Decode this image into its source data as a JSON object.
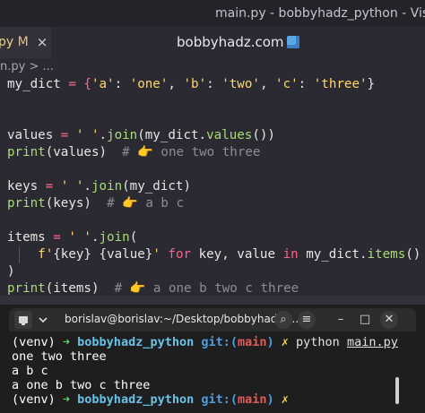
{
  "window": {
    "title": "main.py - bobbyhadz_python - Visual Studio"
  },
  "tab": {
    "label": "py",
    "modified": "M",
    "close": "×"
  },
  "header": {
    "center_title": "bobbyhadz.com"
  },
  "breadcrumb": {
    "text": "n.py > ..."
  },
  "code": {
    "l1": {
      "a": "my_dict",
      "b": " = {",
      "c": "'a'",
      "d": ": ",
      "e": "'one'",
      "f": ", ",
      "g": "'b'",
      "h": ": ",
      "i": "'two'",
      "j": ", ",
      "k": "'c'",
      "l": ": ",
      "m": "'three'",
      "n": "}"
    },
    "l4": {
      "a": "values",
      "b": " = ",
      "c": "' '",
      "d": ".",
      "e": "join",
      "f": "(my_dict.",
      "g": "values",
      "h": "())"
    },
    "l5": {
      "a": "print",
      "b": "(values)  ",
      "c": "# 👉 one two three"
    },
    "l7": {
      "a": "keys",
      "b": " = ",
      "c": "' '",
      "d": ".",
      "e": "join",
      "f": "(my_dict)"
    },
    "l8": {
      "a": "print",
      "b": "(keys)  ",
      "c": "# 👉 a b c"
    },
    "l10": {
      "a": "items",
      "b": " = ",
      "c": "' '",
      "d": ".",
      "e": "join",
      "f": "("
    },
    "l11": {
      "a": "f'",
      "b": "{key}",
      "c": " ",
      "d": "{value}",
      "e": "'",
      "f": " for ",
      "g": "key, value ",
      "h": "in ",
      "i": "my_dict.",
      "j": "items",
      "k": "()"
    },
    "l12": {
      "a": ")"
    },
    "l13": {
      "a": "print",
      "b": "(items)  ",
      "c": "# 👉 a one b two c three"
    }
  },
  "terminal": {
    "title": "borislav@borislav:~/Desktop/bobbyhadz_...",
    "controls": {
      "search": "⌕",
      "menu": "≡",
      "minimize": "–",
      "maximize": "□",
      "close": "✕"
    },
    "lines": {
      "p1": {
        "venv": "(venv) ",
        "arrow": "➜ ",
        "dir": "bobbyhadz_python ",
        "git": "git:(",
        "branch": "main",
        "git_close": ") ",
        "x": "✗ ",
        "cmd": "python ",
        "arg": "main.py"
      },
      "o1": "one two three",
      "o2": "a b c",
      "o3": "a one b two c three",
      "p2": {
        "venv": "(venv) ",
        "arrow": "➜ ",
        "dir": "bobbyhadz_python ",
        "git": "git:(",
        "branch": "main",
        "git_close": ") ",
        "x": "✗"
      }
    }
  },
  "colors": {
    "editor_bg": "#2b2a33",
    "terminal_bg": "#1e1e1e",
    "string": "#ffd866",
    "keyword": "#ff6188",
    "function": "#a9dc76"
  }
}
